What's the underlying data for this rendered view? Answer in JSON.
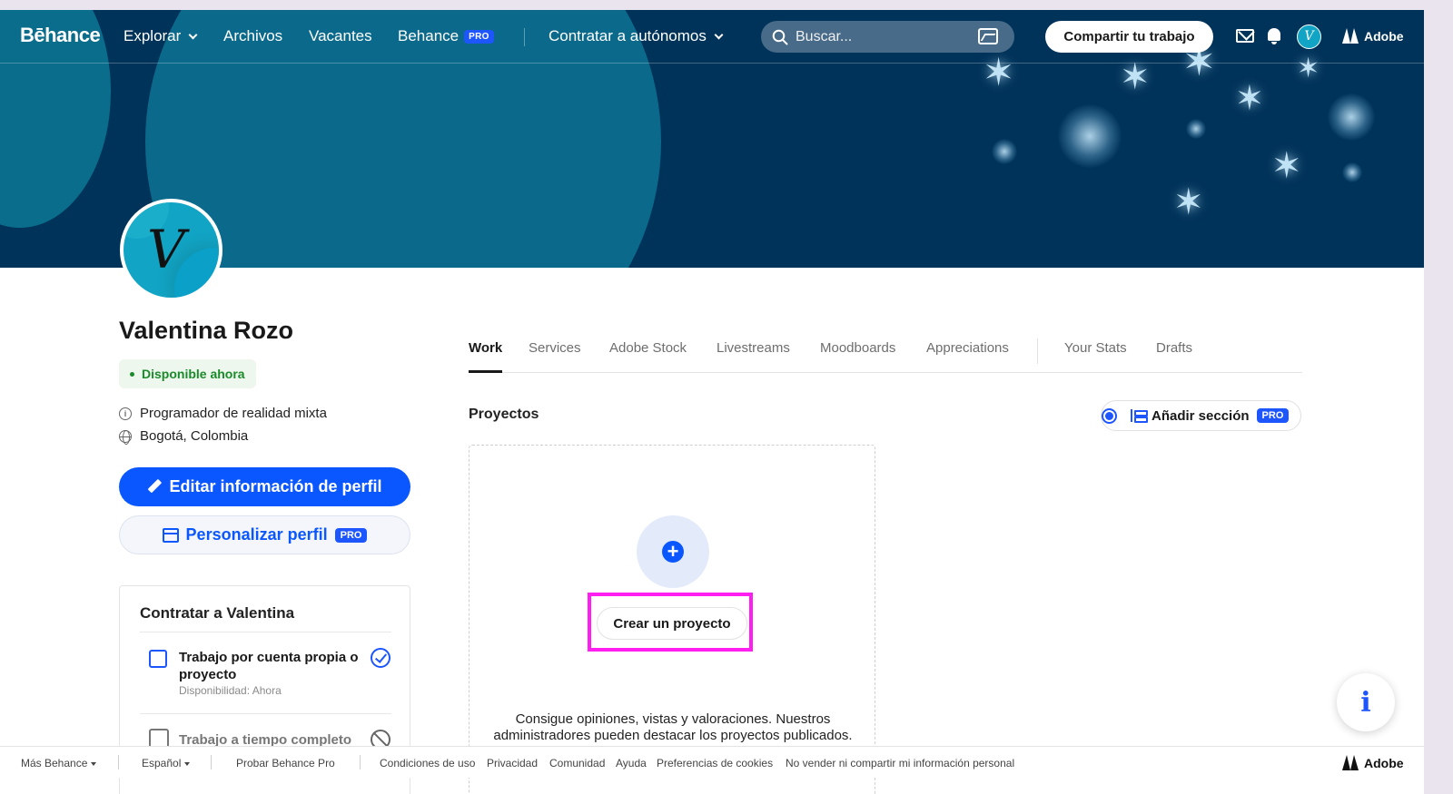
{
  "nav": {
    "logo": "Bēhance",
    "explore": "Explorar",
    "files": "Archivos",
    "jobs": "Vacantes",
    "behance_pro": "Behance",
    "pro_badge": "PRO",
    "hire_freelancers": "Contratar a autónomos",
    "search_placeholder": "Buscar...",
    "share_button": "Compartir tu trabajo",
    "adobe": "Adobe",
    "avatar_initial": "V"
  },
  "profile": {
    "avatar_initial": "V",
    "name": "Valentina Rozo",
    "availability": "Disponible ahora",
    "occupation": "Programador de realidad mixta",
    "location": "Bogotá, Colombia",
    "edit_button": "Editar información de perfil",
    "customize_button": "Personalizar perfil",
    "pro_badge": "PRO"
  },
  "hire": {
    "title": "Contratar a Valentina",
    "options": [
      {
        "title": "Trabajo por cuenta propia o proyecto",
        "subtitle": "Disponibilidad: Ahora",
        "enabled": true
      },
      {
        "title": "Trabajo a tiempo completo",
        "enabled": false
      }
    ]
  },
  "tabs": [
    "Work",
    "Services",
    "Adobe Stock",
    "Livestreams",
    "Moodboards",
    "Appreciations",
    "Your Stats",
    "Drafts"
  ],
  "projects": {
    "section_title": "Proyectos",
    "add_section": "Añadir sección",
    "pro_badge": "PRO",
    "create_button": "Crear un proyecto",
    "description": "Consigue opiniones, vistas y valoraciones. Nuestros administradores pueden destacar los proyectos publicados."
  },
  "info_fab": "i",
  "footer": {
    "more": "Más Behance",
    "language": "Español",
    "try_pro": "Probar Behance Pro",
    "terms": "Condiciones de uso",
    "privacy": "Privacidad",
    "community": "Comunidad",
    "help": "Ayuda",
    "cookies": "Preferencias de cookies",
    "do_not_sell": "No vender ni compartir mi información personal",
    "adobe": "Adobe"
  },
  "colors": {
    "accent": "#0b57ff",
    "banner": "#00335a",
    "available": "#1b8a2a",
    "highlight": "#ff1ef0"
  }
}
